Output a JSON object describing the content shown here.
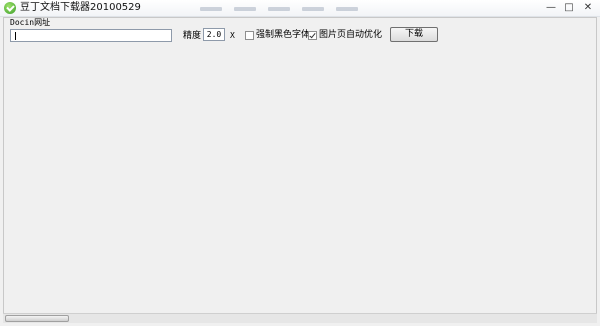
{
  "window": {
    "title": "豆丁文档下载器20100529",
    "buttons": {
      "minimize": "—",
      "maximize": "□",
      "close": "✕"
    }
  },
  "form": {
    "url_label": "Docin网址",
    "url_value": "",
    "precision_label": "精度",
    "precision_value": "2.0",
    "times_label": "X",
    "checkbox_force_black": {
      "label": "强制黑色字体",
      "checked": false
    },
    "checkbox_page_optimize": {
      "label": "图片页自动优化",
      "checked": true
    },
    "download_button": "下载"
  }
}
